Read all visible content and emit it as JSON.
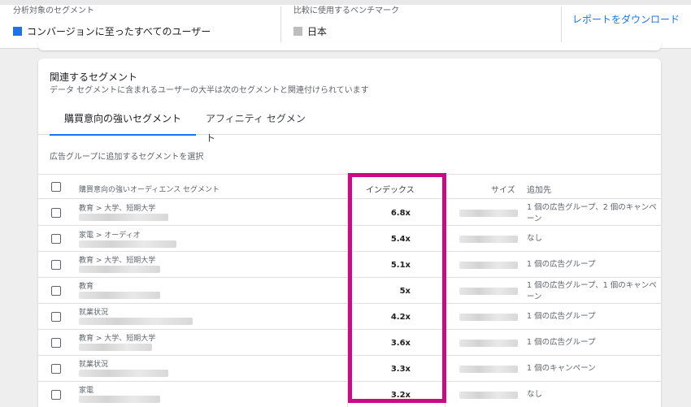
{
  "header": {
    "analysis_label": "分析対象のセグメント",
    "analysis_value": "コンバージョンに至ったすべてのユーザー",
    "analysis_color": "#1a73e8",
    "benchmark_label": "比較に使用するベンチマーク",
    "benchmark_value": "日本",
    "benchmark_color": "#bdbdbd",
    "download_label": "レポートをダウンロード"
  },
  "card": {
    "title": "関連するセグメント",
    "subtitle": "データ セグメントに含まれるユーザーの大半は次のセグメントと関連付けられています",
    "tabs": [
      "購買意向の強いセグメント",
      "アフィニティ セグメント"
    ],
    "active_tab": 0,
    "instruction": "広告グループに追加するセグメントを選択"
  },
  "table": {
    "headers": {
      "segment": "購買意向の強いオーディエンス セグメント",
      "index": "インデックス",
      "size": "サイズ",
      "added_to": "追加先"
    },
    "rows": [
      {
        "category": "教育 > 大学、短期大学",
        "index": "6.8x",
        "added_to": "1 個の広告グループ、2 個のキャンペーン"
      },
      {
        "category": "家電 > オーディオ",
        "index": "5.4x",
        "added_to": "なし"
      },
      {
        "category": "教育 > 大学、短期大学",
        "index": "5.1x",
        "added_to": "1 個の広告グループ"
      },
      {
        "category": "教育",
        "index": "5x",
        "added_to": "1 個の広告グループ、1 個のキャンペーン"
      },
      {
        "category": "就業状況",
        "index": "4.2x",
        "added_to": "1 個の広告グループ"
      },
      {
        "category": "教育 > 大学、短期大学",
        "index": "3.6x",
        "added_to": "1 個の広告グループ"
      },
      {
        "category": "就業状況",
        "index": "3.3x",
        "added_to": "1 個のキャンペーン"
      },
      {
        "category": "家電",
        "index": "3.2x",
        "added_to": "なし"
      }
    ]
  },
  "highlight_color": "#cc0a86"
}
